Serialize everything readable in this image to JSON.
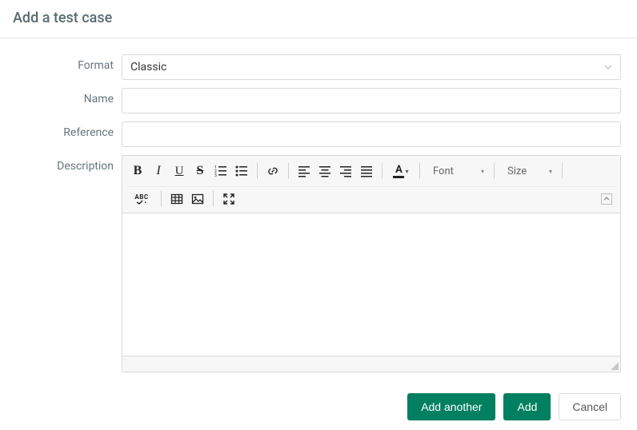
{
  "header": {
    "title": "Add a test case"
  },
  "labels": {
    "format": "Format",
    "name": "Name",
    "reference": "Reference",
    "description": "Description"
  },
  "fields": {
    "format_value": "Classic",
    "name_value": "",
    "reference_value": ""
  },
  "editor": {
    "font_label": "Font",
    "size_label": "Size",
    "spellcheck_label": "ABC"
  },
  "actions": {
    "add_another": "Add another",
    "add": "Add",
    "cancel": "Cancel"
  }
}
